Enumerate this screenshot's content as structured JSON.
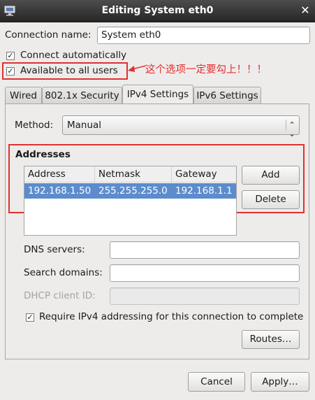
{
  "window": {
    "title": "Editing System eth0"
  },
  "connection": {
    "name_label": "Connection name:",
    "name_value": "System eth0",
    "connect_auto_label": "Connect automatically",
    "connect_auto_checked": true,
    "all_users_label": "Available to all users",
    "all_users_checked": true,
    "annotation": "这个选项一定要勾上！！！"
  },
  "tabs": [
    {
      "label": "Wired"
    },
    {
      "label": "802.1x Security"
    },
    {
      "label": "IPv4 Settings",
      "active": true
    },
    {
      "label": "IPv6 Settings"
    }
  ],
  "ipv4": {
    "method_label": "Method:",
    "method_value": "Manual",
    "addresses_heading": "Addresses",
    "columns": [
      "Address",
      "Netmask",
      "Gateway"
    ],
    "rows": [
      {
        "address": "192.168.1.50",
        "netmask": "255.255.255.0",
        "gateway": "192.168.1.1"
      }
    ],
    "add_label": "Add",
    "delete_label": "Delete",
    "dns_label": "DNS servers:",
    "dns_value": "",
    "search_label": "Search domains:",
    "search_value": "",
    "dhcp_label": "DHCP client ID:",
    "dhcp_value": "",
    "require_label": "Require IPv4 addressing for this connection to complete",
    "require_checked": true,
    "routes_label": "Routes…"
  },
  "footer": {
    "cancel_label": "Cancel",
    "apply_label": "Apply…"
  },
  "colors": {
    "annotation_red": "#e23030",
    "selection": "#5c8ccc",
    "titlebar": "#333333"
  }
}
